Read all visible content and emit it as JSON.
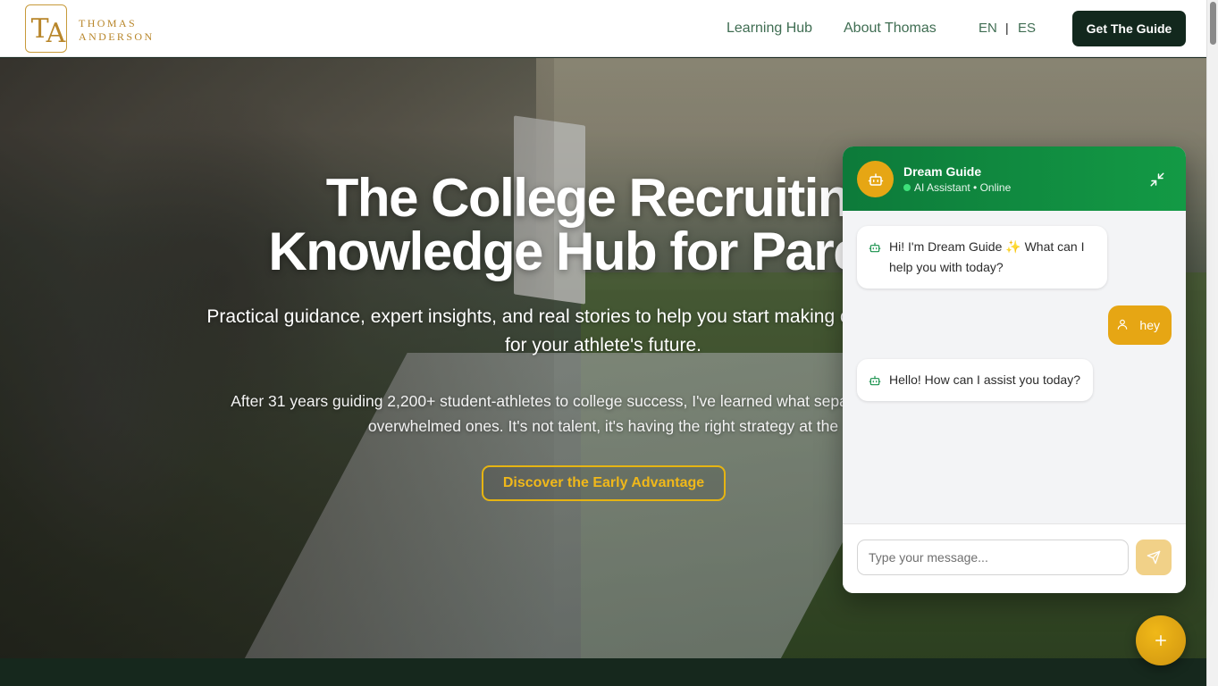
{
  "header": {
    "logo_monogram_left": "T",
    "logo_monogram_right": "A",
    "logo_line1": "THOMAS",
    "logo_line2": "ANDERSON",
    "nav": [
      "Learning Hub",
      "About Thomas"
    ],
    "lang_en": "EN",
    "lang_sep": "|",
    "lang_es": "ES",
    "cta_label": "Get The Guide"
  },
  "hero": {
    "title_line1": "The College Recruiting",
    "title_line2": "Knowledge Hub for Parents",
    "subtitle": "Practical guidance, expert insights, and real stories to help you start making confident decisions for your athlete's future.",
    "body": "After 31 years guiding 2,200+ student-athletes to college success, I've learned what separates families from overwhelmed ones. It's not talent, it's having the right strategy at the",
    "button_label": "Discover the Early Advantage"
  },
  "chat": {
    "title": "Dream Guide",
    "status": "AI Assistant • Online",
    "messages": [
      {
        "role": "bot",
        "text": "Hi! I'm Dream Guide ✨ What can I help you with today?"
      },
      {
        "role": "user",
        "text": "hey"
      },
      {
        "role": "bot",
        "text": "Hello! How can I assist you today?"
      }
    ],
    "input_placeholder": "Type your message..."
  },
  "colors": {
    "brand_gold": "#b8862a",
    "nav_green": "#3f6d52",
    "dark_green": "#12281d",
    "chat_header_green": "#139a45",
    "accent_amber": "#e6a614",
    "cta_outline": "#e6b412"
  },
  "icons": {
    "bot": "robot-icon",
    "user": "user-icon",
    "minimize": "minimize-icon",
    "send": "send-icon",
    "fab": "plus-icon"
  }
}
